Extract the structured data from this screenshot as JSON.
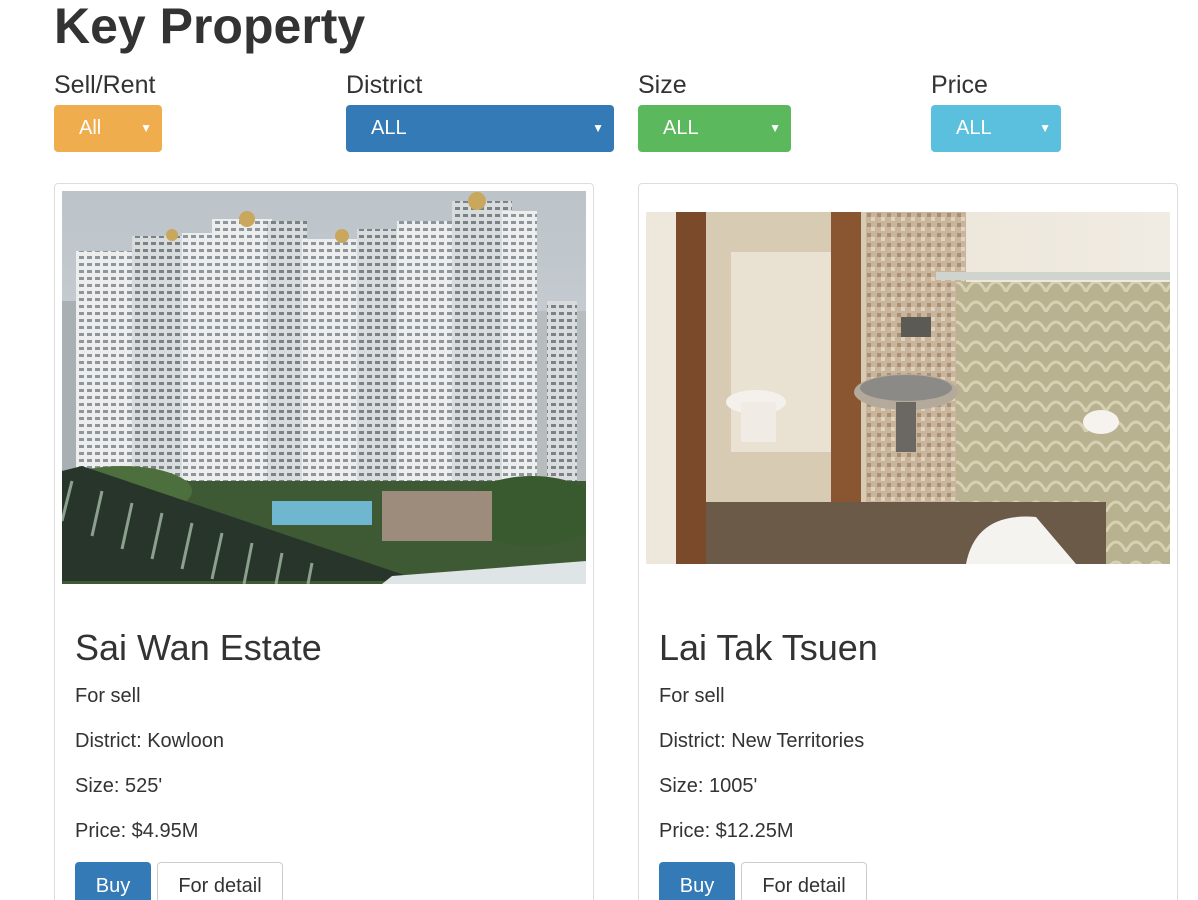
{
  "page": {
    "title": "Key Property"
  },
  "filters": [
    {
      "label": "Sell/Rent",
      "value": "All",
      "color": "#f0ad4e"
    },
    {
      "label": "District",
      "value": "ALL",
      "color": "#337ab7"
    },
    {
      "label": "Size",
      "value": "ALL",
      "color": "#5cb85c"
    },
    {
      "label": "Price",
      "value": "ALL",
      "color": "#5bc0de"
    }
  ],
  "listings": [
    {
      "name": "Sai Wan Estate",
      "type": "For sell",
      "district": "District: Kowloon",
      "size": "Size: 525'",
      "price": "Price: $4.95M",
      "buy_label": "Buy",
      "detail_label": "For detail"
    },
    {
      "name": "Lai Tak Tsuen",
      "type": "For sell",
      "district": "District: New Territories",
      "size": "Size: 1005'",
      "price": "Price: $12.25M",
      "buy_label": "Buy",
      "detail_label": "For detail"
    }
  ],
  "colors": {
    "primary": "#337ab7",
    "warning": "#f0ad4e",
    "success": "#5cb85c",
    "info": "#5bc0de"
  },
  "icons": {
    "caret": "caret-down-icon"
  }
}
